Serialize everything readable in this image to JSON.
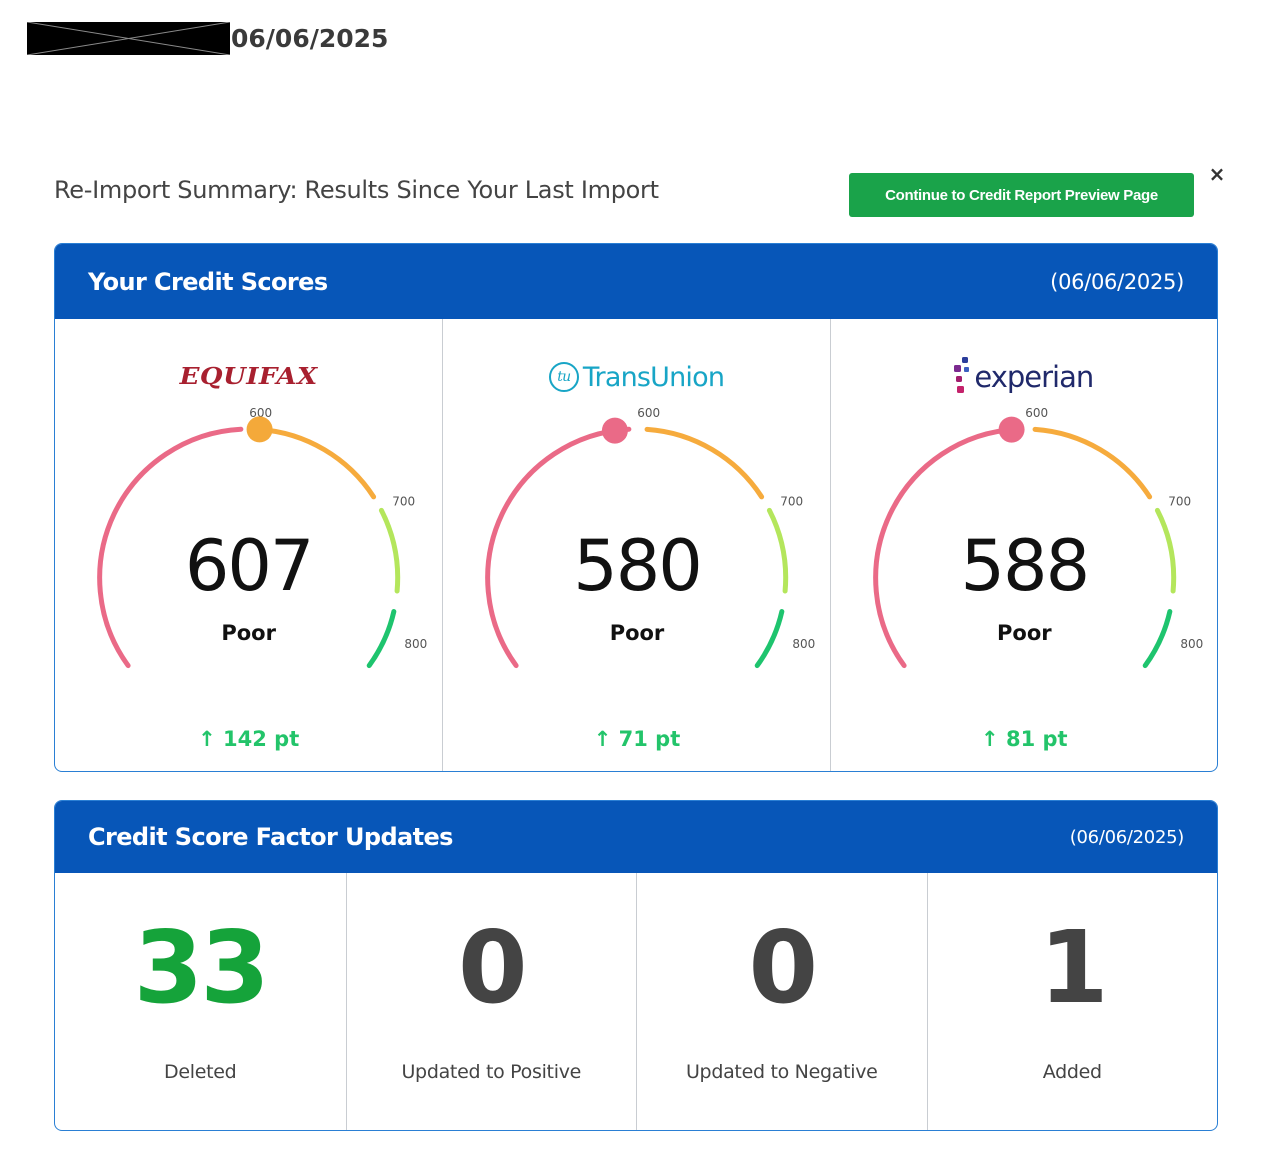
{
  "header": {
    "date": "06/06/2025"
  },
  "summary": {
    "title": "Re-Import Summary: Results Since Your Last Import",
    "continue_label": "Continue to Credit Report Preview Page",
    "close_glyph": "×"
  },
  "scores_panel": {
    "title": "Your Credit Scores",
    "date": "(06/06/2025)",
    "tick_labels": [
      "600",
      "700",
      "800"
    ],
    "bureaus": [
      {
        "logo_text": "EQUIFAX",
        "score": 607,
        "rating": "Poor",
        "change": "142 pt",
        "marker_color": "#f4a93a",
        "logo_color": "#a8202f"
      },
      {
        "logo_badge": "tu",
        "logo_text": "TransUnion",
        "score": 580,
        "rating": "Poor",
        "change": "71 pt",
        "marker_color": "#ea6a87",
        "logo_color": "#18a5c6"
      },
      {
        "logo_text": "experian",
        "score": 588,
        "rating": "Poor",
        "change": "81 pt",
        "marker_color": "#ea6a87",
        "logo_color": "#20296b"
      }
    ],
    "change_icon": "arrow-up-icon",
    "colors": {
      "poor": "#ea6a87",
      "fair": "#f6ab3d",
      "good": "#b4e65c",
      "excellent": "#1ec46e",
      "change": "#23c46a"
    }
  },
  "factors_panel": {
    "title": "Credit Score Factor Updates",
    "date": "(06/06/2025)",
    "items": [
      {
        "count": "33",
        "label": "Deleted",
        "highlight": true
      },
      {
        "count": "0",
        "label": "Updated to Positive",
        "highlight": false
      },
      {
        "count": "0",
        "label": "Updated to Negative",
        "highlight": false
      },
      {
        "count": "1",
        "label": "Added",
        "highlight": false
      }
    ]
  }
}
